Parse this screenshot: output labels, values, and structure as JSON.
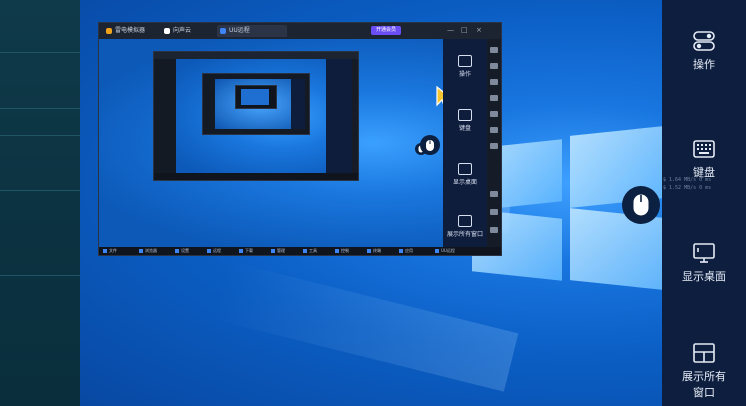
{
  "remote_window": {
    "tabs": [
      {
        "label": "雷电模拟器"
      },
      {
        "label": "向声云"
      },
      {
        "label": "UU远程"
      }
    ],
    "badge": "开通会员",
    "window_controls": [
      "—",
      "□",
      "×"
    ],
    "side_items": [
      "操作",
      "键盘",
      "显示桌面",
      "展示所有窗口"
    ],
    "taskbar_items": [
      "文件",
      "浏览器",
      "设置",
      "远程",
      "下载",
      "管理",
      "工具",
      "控制",
      "终端",
      "应用",
      "UU远程"
    ]
  },
  "side_panel": {
    "items": [
      {
        "label": "操作",
        "icon": "toggle-icon"
      },
      {
        "label": "键盘",
        "icon": "keyboard-icon"
      },
      {
        "label": "显示桌面",
        "icon": "monitor-icon"
      },
      {
        "label": "展示所有\n窗口",
        "label_line1": "展示所有",
        "label_line2": "窗口",
        "icon": "windows-grid-icon"
      }
    ]
  },
  "overlay_lines": [
    "$ 1.64 MB/s  0 ms",
    "$ 1.52 MB/s  0 ms"
  ],
  "colors": {
    "side_panel_bg": "#0d1e3f",
    "desktop_blue": "#0b5ec4",
    "accent_purple": "#6b4df5",
    "left_strip": "#0f3a4a"
  }
}
